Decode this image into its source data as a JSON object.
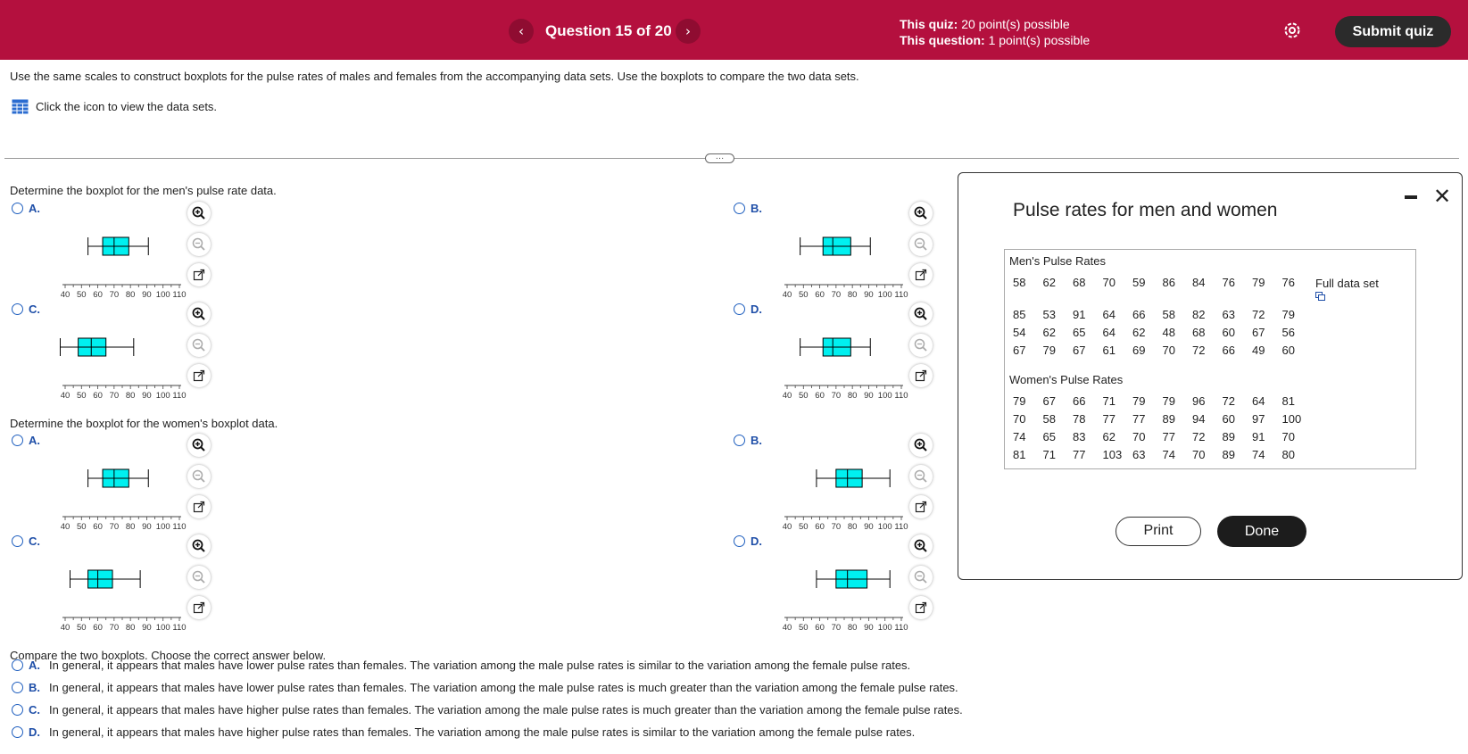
{
  "header": {
    "question_label": "Question 15 of 20",
    "quiz_label": "This quiz:",
    "quiz_points": "20 point(s) possible",
    "question_points_label": "This question:",
    "question_points": "1 point(s) possible",
    "submit_label": "Submit quiz"
  },
  "instructions": "Use the same scales to construct boxplots for the pulse rates of males and females from the accompanying data sets. Use the boxplots to compare the two data sets.",
  "dataset_link": "Click the icon to view the data sets.",
  "men_prompt": "Determine the boxplot for the men's pulse rate data.",
  "women_prompt": "Determine the boxplot for the women's boxplot data.",
  "axis_ticks": [
    "40",
    "50",
    "60",
    "70",
    "80",
    "90",
    "100",
    "110"
  ],
  "men_options": [
    {
      "letter": "A.",
      "min": 54,
      "q1": 63,
      "median": 70,
      "q3": 79,
      "max": 91
    },
    {
      "letter": "B.",
      "min": 48,
      "q1": 62,
      "median": 68,
      "q3": 79,
      "max": 91
    },
    {
      "letter": "C.",
      "min": 37,
      "q1": 48,
      "median": 56,
      "q3": 65,
      "max": 82
    },
    {
      "letter": "D.",
      "min": 48,
      "q1": 62,
      "median": 68,
      "q3": 79,
      "max": 91
    }
  ],
  "women_options": [
    {
      "letter": "A.",
      "min": 54,
      "q1": 63,
      "median": 70,
      "q3": 79,
      "max": 91
    },
    {
      "letter": "B.",
      "min": 58,
      "q1": 70,
      "median": 77,
      "q3": 86,
      "max": 103
    },
    {
      "letter": "C.",
      "min": 43,
      "q1": 54,
      "median": 60,
      "q3": 69,
      "max": 86
    },
    {
      "letter": "D.",
      "min": 58,
      "q1": 70,
      "median": 77,
      "q3": 89,
      "max": 103
    }
  ],
  "compare_prompt": "Compare the two boxplots. Choose the correct answer below.",
  "answers": [
    {
      "letter": "A.",
      "text": "In general, it appears that males have lower pulse rates than females. The variation  among the male pulse rates is similar to the variation among the female pulse rates."
    },
    {
      "letter": "B.",
      "text": "In general, it appears that males have lower pulse rates than females. The variation among the male pulse rates is much greater than the variation among the female pulse rates."
    },
    {
      "letter": "C.",
      "text": "In general, it appears that males have higher pulse rates than females. The variation among the male pulse rates is much greater than the variation among the female pulse rates."
    },
    {
      "letter": "D.",
      "text": "In general, it appears that males have higher pulse rates than females. The variation among the male pulse rates is similar to the variation among the female pulse rates."
    }
  ],
  "popup": {
    "title": "Pulse rates for men and women",
    "men_header": "Men's Pulse Rates",
    "men_rows": [
      [
        "58",
        "62",
        "68",
        "70",
        "59",
        "86",
        "84",
        "76",
        "79",
        "76"
      ],
      [
        "85",
        "53",
        "91",
        "64",
        "66",
        "58",
        "82",
        "63",
        "72",
        "79"
      ],
      [
        "54",
        "62",
        "65",
        "64",
        "62",
        "48",
        "68",
        "60",
        "67",
        "56"
      ],
      [
        "67",
        "79",
        "67",
        "61",
        "69",
        "70",
        "72",
        "66",
        "49",
        "60"
      ]
    ],
    "full_data": "Full data set",
    "women_header": "Women's Pulse Rates",
    "women_rows": [
      [
        "79",
        "67",
        "66",
        "71",
        "79",
        "79",
        "96",
        "72",
        "64",
        "81"
      ],
      [
        "70",
        "58",
        "78",
        "77",
        "77",
        "89",
        "94",
        "60",
        "97",
        "100"
      ],
      [
        "74",
        "65",
        "83",
        "62",
        "70",
        "77",
        "72",
        "89",
        "91",
        "70"
      ],
      [
        "81",
        "71",
        "77",
        "103",
        "63",
        "74",
        "70",
        "89",
        "74",
        "80"
      ]
    ],
    "print_label": "Print",
    "done_label": "Done"
  },
  "colors": {
    "header": "#b4103e",
    "box_fill": "#00f0f0",
    "accent": "#1f4fa8"
  }
}
